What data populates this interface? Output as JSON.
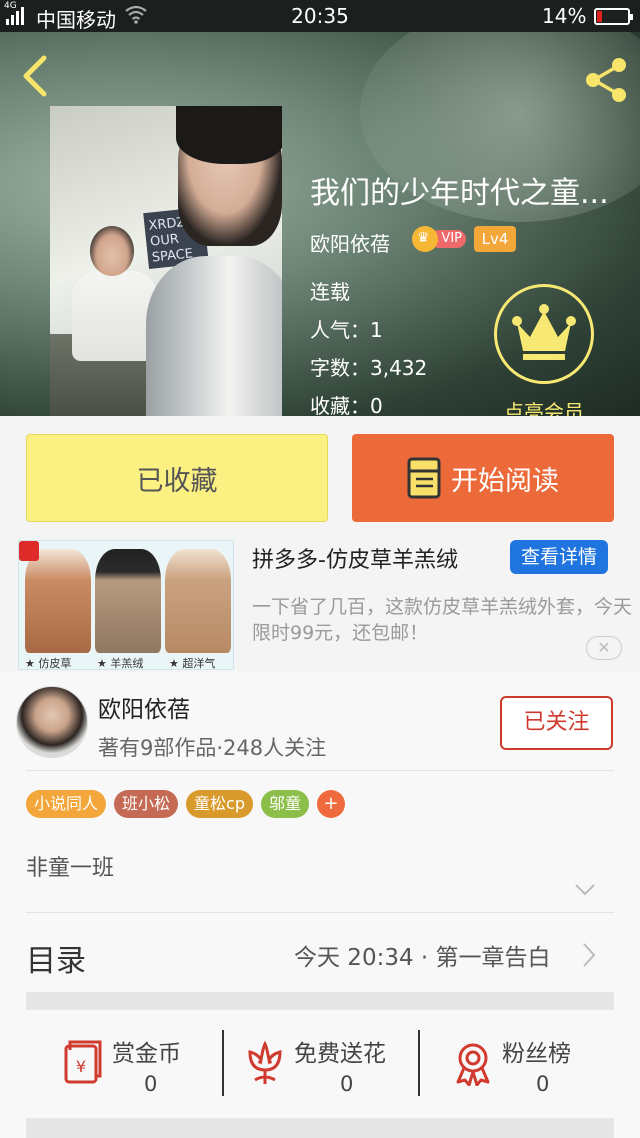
{
  "status_bar": {
    "network": "4G",
    "carrier": "中国移动",
    "time": "20:35",
    "battery": "14%",
    "battery_level": 0.14
  },
  "book": {
    "title": "我们的少年时代之童...",
    "author": "欧阳依蓓",
    "vip_label": "VIP",
    "level": "Lv4",
    "status": "连载",
    "popularity": "人气：1",
    "word_count": "字数：3,432",
    "favorites": "收藏：0",
    "member_label": "点亮会员",
    "cover_board_text": "XRDZ OUR SPACE"
  },
  "actions": {
    "collected_label": "已收藏",
    "read_label": "开始阅读"
  },
  "ad": {
    "title": "拼多多-仿皮草羊羔绒",
    "detail_label": "查看详情",
    "description": "一下省了几百，这款仿皮草羊羔绒外套，今天限时99元，还包邮！",
    "captions": [
      "仿皮草",
      "羊羔绒",
      "超洋气"
    ]
  },
  "author": {
    "name": "欧阳依蓓",
    "stats": "著有9部作品·248人关注",
    "follow_label": "已关注"
  },
  "tags": [
    {
      "label": "小说同人",
      "color": "#f3a63a"
    },
    {
      "label": "班小松",
      "color": "#c46a55"
    },
    {
      "label": "童松cp",
      "color": "#d99a2c"
    },
    {
      "label": "邬童",
      "color": "#8cbf4a"
    }
  ],
  "tag_add": "+",
  "intro": "非童一班",
  "toc": {
    "label": "目录",
    "latest": "今天 20:34 · 第一章告白"
  },
  "bottom_actions": [
    {
      "label": "赏金币",
      "count": "0",
      "icon": "red-envelope-icon"
    },
    {
      "label": "免费送花",
      "count": "0",
      "icon": "flower-icon"
    },
    {
      "label": "粉丝榜",
      "count": "0",
      "icon": "medal-icon"
    }
  ],
  "colors": {
    "accent_orange": "#ec6a3a",
    "collected_yellow": "#fbf082",
    "follow_red": "#cf3a2e",
    "crown_yellow": "#f7e873"
  }
}
